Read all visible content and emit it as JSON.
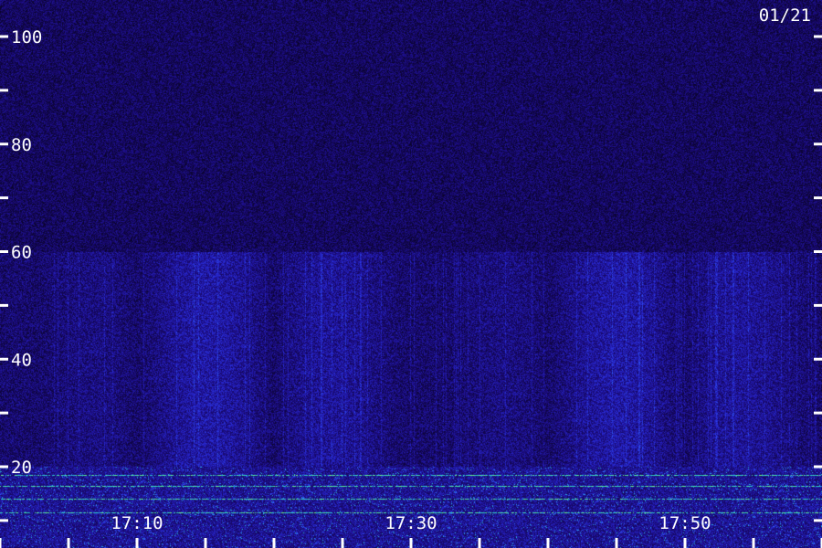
{
  "chart_data": {
    "type": "heatmap",
    "date_label": "01/21",
    "y_ticks": [
      20,
      40,
      60,
      80,
      100
    ],
    "y_minor_ticks": [
      10,
      30,
      50,
      70,
      90
    ],
    "ylim": [
      10,
      106
    ],
    "x_tick_labels": [
      "17:10",
      "17:30",
      "17:50"
    ],
    "x_range_minutes": [
      "17:05",
      "18:05"
    ],
    "x_label_minutes": [
      10,
      30,
      50
    ],
    "x_minor_every_minutes": 5,
    "colormap": [
      "#08031f",
      "#1a0a8a",
      "#2a2ad8",
      "#2f6cff",
      "#29d6c8",
      "#7cff7a"
    ],
    "bands": [
      {
        "description_from": 10,
        "to": 19,
        "level": "high"
      },
      {
        "from": 19,
        "to": 60,
        "level": "medium"
      },
      {
        "from": 60,
        "to": 106,
        "level": "low"
      }
    ],
    "lines_at": [
      18.5,
      16.5,
      14,
      11.5
    ]
  }
}
